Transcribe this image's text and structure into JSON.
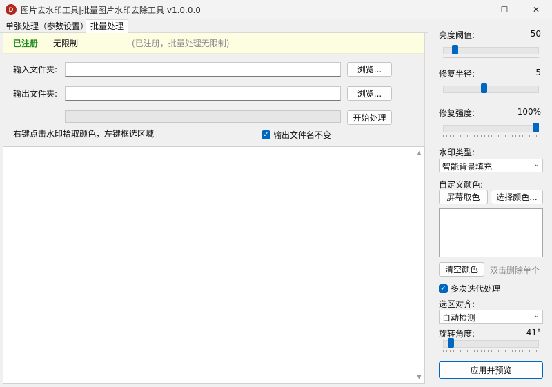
{
  "window": {
    "icon_letter": "D",
    "title": "图片去水印工具|批量图片水印去除工具 v1.0.0.0",
    "minimize_glyph": "—",
    "maximize_glyph": "☐",
    "close_glyph": "✕"
  },
  "tabs": [
    {
      "label": "单张处理（参数设置）",
      "active": false
    },
    {
      "label": "批量处理",
      "active": true
    }
  ],
  "registration": {
    "status": "已注册",
    "type": "无限制",
    "note": "(已注册，批量处理无限制)"
  },
  "batch": {
    "input_label": "输入文件夹:",
    "input_value": "",
    "output_label": "输出文件夹:",
    "output_value": "",
    "browse_label": "浏览...",
    "start_label": "开始处理",
    "progress": 0,
    "hint": "右键点击水印拾取颜色，左键框选区域",
    "keep_name_label": "输出文件名不变",
    "keep_name_checked": true
  },
  "settings": {
    "brightness": {
      "label": "亮度阈值:",
      "value": "50",
      "fraction": 0.1
    },
    "radius": {
      "label": "修复半径:",
      "value": "5",
      "fraction": 0.42
    },
    "strength": {
      "label": "修复强度:",
      "value": "100%",
      "fraction": 1.0
    },
    "watermark_type": {
      "label": "水印类型:",
      "selected": "智能背景填充"
    },
    "custom_color": {
      "label": "自定义颜色:",
      "screen_pick_label": "屏幕取色",
      "choose_color_label": "选择颜色...",
      "clear_label": "清空颜色",
      "clear_hint": "双击删除单个"
    },
    "multi_iter": {
      "label": "多次迭代处理",
      "checked": true
    },
    "align": {
      "label": "选区对齐:",
      "selected": "自动检测"
    },
    "rotation": {
      "label": "旋转角度:",
      "value": "-41°",
      "fraction": 0.05
    },
    "apply_label": "应用并预览"
  },
  "colors": {
    "accent": "#0067c0",
    "registered_green": "#1c8a1c",
    "reg_strip_bg": "#fdfde2",
    "app_icon": "#b3261e"
  }
}
